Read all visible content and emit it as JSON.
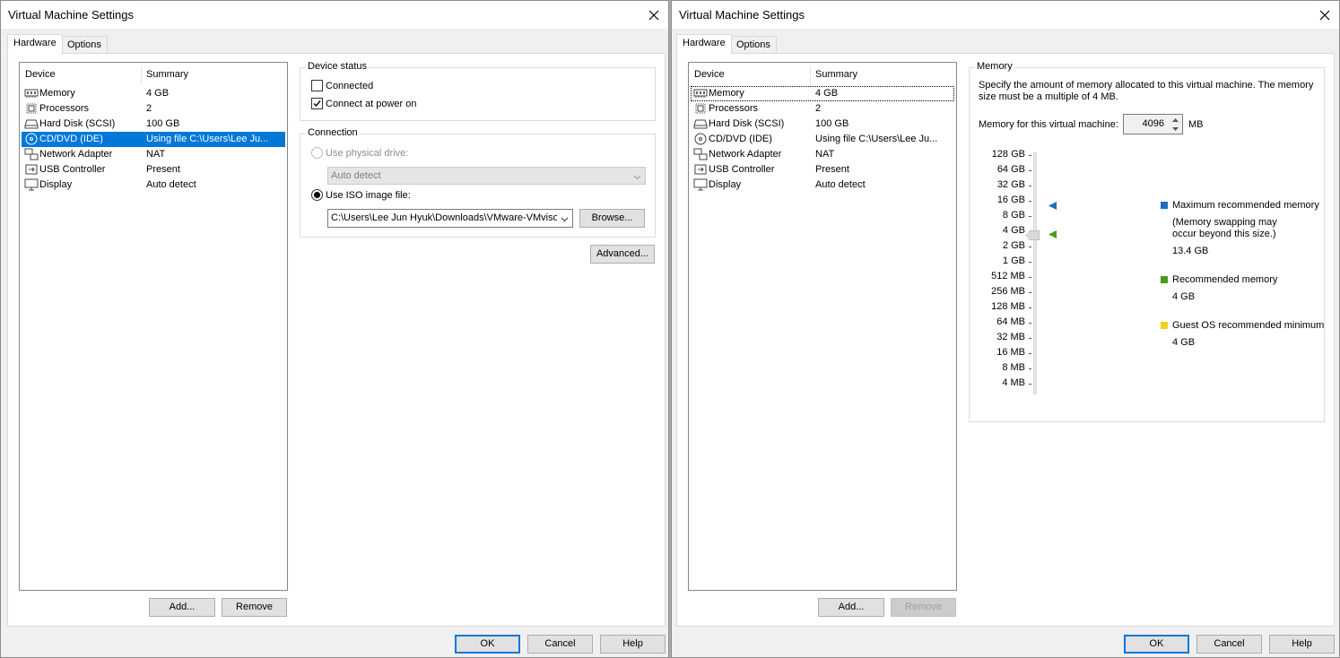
{
  "left_dialog": {
    "title": "Virtual Machine Settings",
    "tabs": [
      {
        "label": "Hardware"
      },
      {
        "label": "Options"
      }
    ],
    "columns": {
      "device": "Device",
      "summary": "Summary"
    },
    "devices": [
      {
        "name": "Memory",
        "summary": "4 GB",
        "icon": "memory-icon"
      },
      {
        "name": "Processors",
        "summary": "2",
        "icon": "processor-icon"
      },
      {
        "name": "Hard Disk (SCSI)",
        "summary": "100 GB",
        "icon": "hard-disk-icon"
      },
      {
        "name": "CD/DVD (IDE)",
        "summary": "Using file C:\\Users\\Lee Ju...",
        "icon": "cd-dvd-icon"
      },
      {
        "name": "Network Adapter",
        "summary": "NAT",
        "icon": "network-adapter-icon"
      },
      {
        "name": "USB Controller",
        "summary": "Present",
        "icon": "usb-icon"
      },
      {
        "name": "Display",
        "summary": "Auto detect",
        "icon": "display-icon"
      }
    ],
    "add_label": "Add...",
    "remove_label": "Remove",
    "device_status": {
      "title": "Device status",
      "connected": "Connected",
      "connect_at_power_on": "Connect at power on"
    },
    "connection": {
      "title": "Connection",
      "use_physical_drive": "Use physical drive:",
      "physical_drive_value": "Auto detect",
      "use_iso": "Use ISO image file:",
      "iso_path": "C:\\Users\\Lee Jun Hyuk\\Downloads\\VMware-VMvisor-Installer",
      "browse_label": "Browse..."
    },
    "advanced_label": "Advanced...",
    "ok_label": "OK",
    "cancel_label": "Cancel",
    "help_label": "Help"
  },
  "right_dialog": {
    "title": "Virtual Machine Settings",
    "tabs": [
      {
        "label": "Hardware"
      },
      {
        "label": "Options"
      }
    ],
    "columns": {
      "device": "Device",
      "summary": "Summary"
    },
    "devices": [
      {
        "name": "Memory",
        "summary": "4 GB",
        "icon": "memory-icon"
      },
      {
        "name": "Processors",
        "summary": "2",
        "icon": "processor-icon"
      },
      {
        "name": "Hard Disk (SCSI)",
        "summary": "100 GB",
        "icon": "hard-disk-icon"
      },
      {
        "name": "CD/DVD (IDE)",
        "summary": "Using file C:\\Users\\Lee Ju...",
        "icon": "cd-dvd-icon"
      },
      {
        "name": "Network Adapter",
        "summary": "NAT",
        "icon": "network-adapter-icon"
      },
      {
        "name": "USB Controller",
        "summary": "Present",
        "icon": "usb-icon"
      },
      {
        "name": "Display",
        "summary": "Auto detect",
        "icon": "display-icon"
      }
    ],
    "add_label": "Add...",
    "remove_label": "Remove",
    "memory": {
      "title": "Memory",
      "description_line1": "Specify the amount of memory allocated to this virtual machine. The memory",
      "description_line2": "size must be a multiple of 4 MB.",
      "field_label": "Memory for this virtual machine:",
      "value": "4096",
      "unit": "MB",
      "scale": [
        "128 GB",
        "64 GB",
        "32 GB",
        "16 GB",
        "8 GB",
        "4 GB",
        "2 GB",
        "1 GB",
        "512 MB",
        "256 MB",
        "128 MB",
        "64 MB",
        "32 MB",
        "16 MB",
        "8 MB",
        "4 MB"
      ],
      "legend": {
        "max_label": "Maximum recommended memory",
        "max_note_line1": "(Memory swapping may",
        "max_note_line2": "occur beyond this size.)",
        "max_value": "13.4 GB",
        "max_color": "#1f6fbd",
        "rec_label": "Recommended memory",
        "rec_value": "4 GB",
        "rec_color": "#4a9a20",
        "min_label": "Guest OS recommended minimum",
        "min_value": "4 GB",
        "min_color": "#f2d21b"
      }
    },
    "ok_label": "OK",
    "cancel_label": "Cancel",
    "help_label": "Help"
  }
}
